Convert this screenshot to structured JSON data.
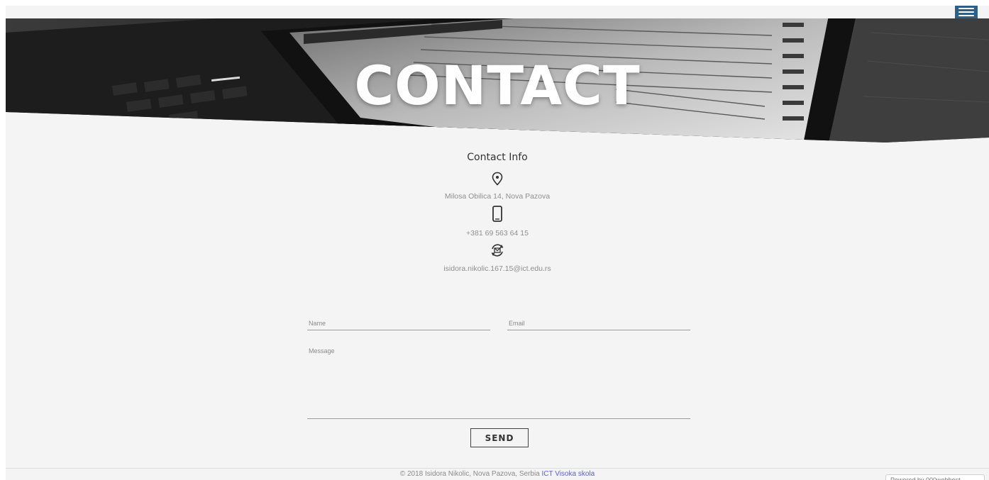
{
  "header": {
    "title": "CONTACT",
    "menu_icon": "hamburger-menu-icon",
    "accent_color": "#2e5f86"
  },
  "contact_info": {
    "title": "Contact Info",
    "items": [
      {
        "icon": "location-pin-icon",
        "text": "Milosa Obilica 14, Nova Pazova"
      },
      {
        "icon": "mobile-phone-icon",
        "text": "+381 69 563 64 15"
      },
      {
        "icon": "email-sync-icon",
        "text": "isidora.nikolic.167.15@ict.edu.rs"
      }
    ]
  },
  "form": {
    "name_placeholder": "Name",
    "email_placeholder": "Email",
    "message_placeholder": "Message",
    "send_label": "SEND"
  },
  "footer": {
    "text": "© 2018 Isidora Nikolic, Nova Pazova, Serbia",
    "link_text": "ICT Visoka skola",
    "link_color": "#5a63c9"
  },
  "badge": {
    "text": "Powered by 000webhost"
  }
}
